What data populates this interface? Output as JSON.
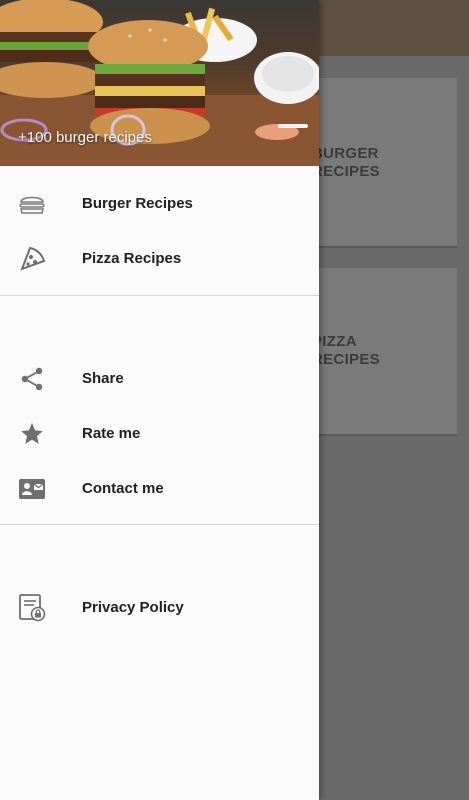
{
  "background": {
    "cards": [
      {
        "title_line1": "BURGER",
        "title_line2": "RECIPES"
      },
      {
        "title_line1": "PIZZA",
        "title_line2": "RECIPES"
      }
    ]
  },
  "drawer": {
    "header": {
      "caption": "+100 burger recipes"
    },
    "section1": [
      {
        "label": "Burger Recipes",
        "icon": "burger-icon"
      },
      {
        "label": "Pizza Recipes",
        "icon": "pizza-icon"
      }
    ],
    "section2": [
      {
        "label": "Share",
        "icon": "share-icon"
      },
      {
        "label": "Rate me",
        "icon": "star-icon"
      },
      {
        "label": "Contact me",
        "icon": "contact-card-icon"
      }
    ],
    "section3": [
      {
        "label": "Privacy Policy",
        "icon": "privacy-policy-icon"
      }
    ]
  },
  "colors": {
    "drawer_bg": "#fafafa",
    "icon_gray": "#6f6f6f",
    "text_dark": "#222222",
    "scrim": "#6a6a6a",
    "appbar": "#5c5140"
  }
}
